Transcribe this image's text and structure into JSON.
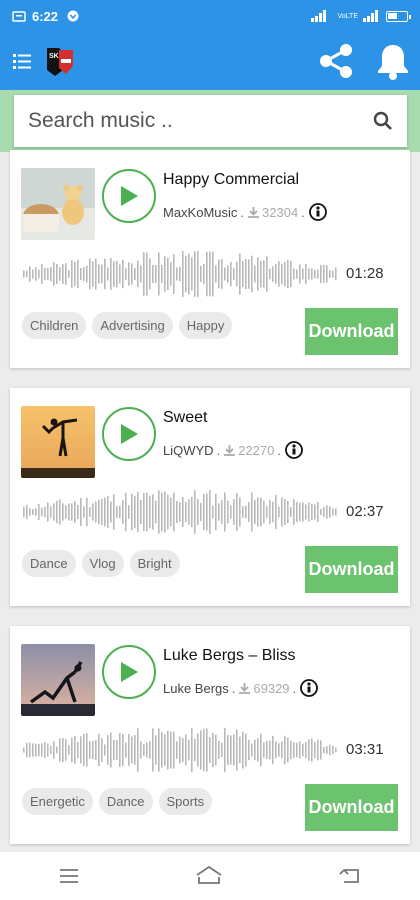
{
  "status_bar": {
    "time": "6:22",
    "signal_labels": [
      "4G",
      "VoLTE",
      "4G"
    ],
    "battery_percent": 0.5
  },
  "app_bar": {
    "logo_text": "SK",
    "icons": [
      "menu-icon",
      "share-icon",
      "bell-icon"
    ]
  },
  "search": {
    "placeholder": "Search music .."
  },
  "tracks": [
    {
      "title": "Happy Commercial",
      "artist": "MaxKoMusic",
      "downloads": "32304",
      "duration": "01:28",
      "tags": [
        "Children",
        "Advertising",
        "Happy"
      ],
      "download_label": "Download"
    },
    {
      "title": "Sweet",
      "artist": "LiQWYD",
      "downloads": "22270",
      "duration": "02:37",
      "tags": [
        "Dance",
        "Vlog",
        "Bright"
      ],
      "download_label": "Download"
    },
    {
      "title": "Luke Bergs – Bliss",
      "artist": "Luke Bergs",
      "downloads": "69329",
      "duration": "03:31",
      "tags": [
        "Energetic",
        "Dance",
        "Sports"
      ],
      "download_label": "Download"
    }
  ],
  "colors": {
    "primary": "#2c93e6",
    "accent_green": "#6cc36f",
    "play_green": "#4caf50",
    "search_band": "#a8dcae"
  }
}
